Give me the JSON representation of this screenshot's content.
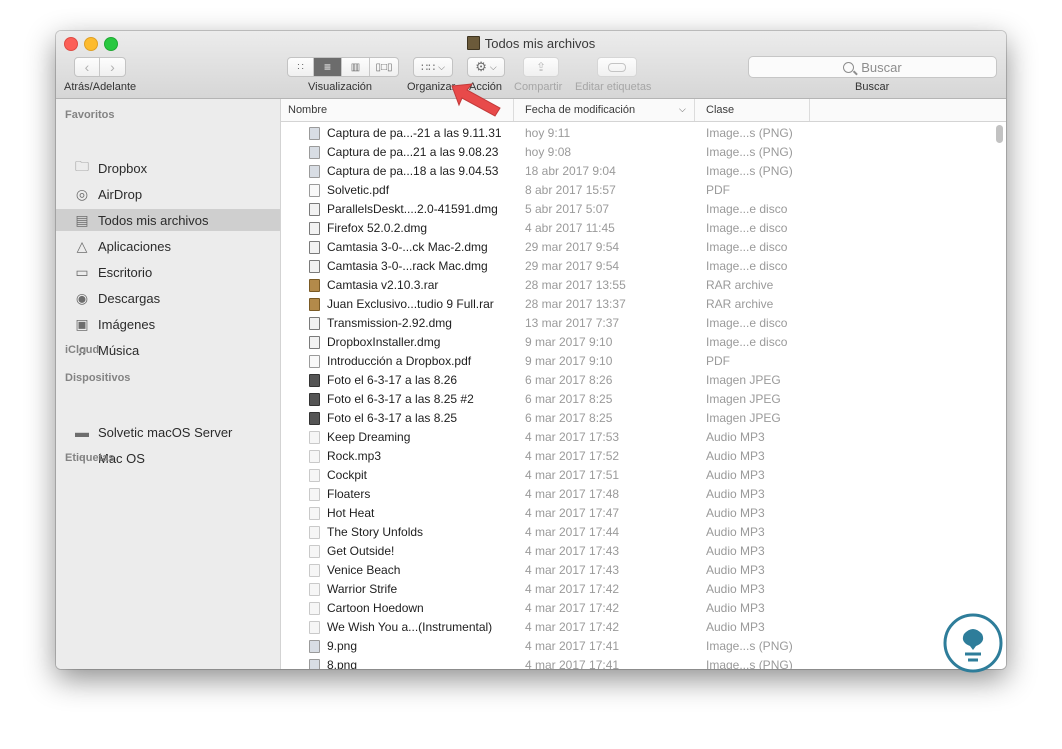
{
  "window": {
    "title": "Todos mis archivos"
  },
  "toolbar": {
    "nav_label": "Atrás/Adelante",
    "view_label": "Visualización",
    "organize_label": "Organizar",
    "action_label": "Acción",
    "share_label": "Compartir",
    "tags_label": "Editar etiquetas",
    "search_placeholder": "Buscar",
    "search_label": "Buscar"
  },
  "sidebar": {
    "favorites_header": "Favoritos",
    "favorites": [
      {
        "label": "Dropbox",
        "icon": "folder-icon"
      },
      {
        "label": "AirDrop",
        "icon": "airdrop-icon"
      },
      {
        "label": "Todos mis archivos",
        "icon": "all-files-icon",
        "selected": true
      },
      {
        "label": "Aplicaciones",
        "icon": "applications-icon"
      },
      {
        "label": "Escritorio",
        "icon": "desktop-icon"
      },
      {
        "label": "Descargas",
        "icon": "downloads-icon"
      },
      {
        "label": "Imágenes",
        "icon": "camera-icon"
      },
      {
        "label": "Música",
        "icon": "music-icon"
      }
    ],
    "icloud_header": "iCloud",
    "devices_header": "Dispositivos",
    "devices": [
      {
        "label": "Solvetic macOS Server",
        "icon": "server-icon"
      },
      {
        "label": "Mac OS",
        "icon": "disk-icon"
      }
    ],
    "tags_header": "Etiquetas"
  },
  "columns": {
    "name": "Nombre",
    "date": "Fecha de modificación",
    "kind": "Clase"
  },
  "files": [
    {
      "name": "Captura de pa...-21 a las 9.11.31",
      "date": "hoy 9:11",
      "kind": "Image...s (PNG)",
      "type": "png"
    },
    {
      "name": "Captura de pa...21 a las 9.08.23",
      "date": "hoy 9:08",
      "kind": "Image...s (PNG)",
      "type": "png"
    },
    {
      "name": "Captura de pa...18 a las 9.04.53",
      "date": "18 abr 2017 9:04",
      "kind": "Image...s (PNG)",
      "type": "png"
    },
    {
      "name": "Solvetic.pdf",
      "date": "8 abr 2017 15:57",
      "kind": "PDF",
      "type": "pdf"
    },
    {
      "name": "ParallelsDeskt....2.0-41591.dmg",
      "date": "5 abr 2017 5:07",
      "kind": "Image...e disco",
      "type": "dmg"
    },
    {
      "name": "Firefox 52.0.2.dmg",
      "date": "4 abr 2017 11:45",
      "kind": "Image...e disco",
      "type": "dmg"
    },
    {
      "name": "Camtasia 3-0-...ck Mac-2.dmg",
      "date": "29 mar 2017 9:54",
      "kind": "Image...e disco",
      "type": "dmg"
    },
    {
      "name": "Camtasia 3-0-...rack Mac.dmg",
      "date": "29 mar 2017 9:54",
      "kind": "Image...e disco",
      "type": "dmg"
    },
    {
      "name": "Camtasia v2.10.3.rar",
      "date": "28 mar 2017 13:55",
      "kind": "RAR archive",
      "type": "rar"
    },
    {
      "name": "Juan Exclusivo...tudio 9 Full.rar",
      "date": "28 mar 2017 13:37",
      "kind": "RAR archive",
      "type": "rar"
    },
    {
      "name": "Transmission-2.92.dmg",
      "date": "13 mar 2017 7:37",
      "kind": "Image...e disco",
      "type": "dmg"
    },
    {
      "name": "DropboxInstaller.dmg",
      "date": "9 mar 2017 9:10",
      "kind": "Image...e disco",
      "type": "dmg"
    },
    {
      "name": "Introducción a Dropbox.pdf",
      "date": "9 mar 2017 9:10",
      "kind": "PDF",
      "type": "pdf"
    },
    {
      "name": "Foto el 6-3-17 a las 8.26",
      "date": "6 mar 2017 8:26",
      "kind": "Imagen JPEG",
      "type": "jpg"
    },
    {
      "name": "Foto el 6-3-17 a las 8.25 #2",
      "date": "6 mar 2017 8:25",
      "kind": "Imagen JPEG",
      "type": "jpg"
    },
    {
      "name": "Foto el 6-3-17 a las 8.25",
      "date": "6 mar 2017 8:25",
      "kind": "Imagen JPEG",
      "type": "jpg"
    },
    {
      "name": "Keep Dreaming",
      "date": "4 mar 2017 17:53",
      "kind": "Audio MP3",
      "type": "mp3"
    },
    {
      "name": "Rock.mp3",
      "date": "4 mar 2017 17:52",
      "kind": "Audio MP3",
      "type": "mp3"
    },
    {
      "name": "Cockpit",
      "date": "4 mar 2017 17:51",
      "kind": "Audio MP3",
      "type": "mp3"
    },
    {
      "name": "Floaters",
      "date": "4 mar 2017 17:48",
      "kind": "Audio MP3",
      "type": "mp3"
    },
    {
      "name": "Hot Heat",
      "date": "4 mar 2017 17:47",
      "kind": "Audio MP3",
      "type": "mp3"
    },
    {
      "name": "The Story Unfolds",
      "date": "4 mar 2017 17:44",
      "kind": "Audio MP3",
      "type": "mp3"
    },
    {
      "name": "Get Outside!",
      "date": "4 mar 2017 17:43",
      "kind": "Audio MP3",
      "type": "mp3"
    },
    {
      "name": "Venice Beach",
      "date": "4 mar 2017 17:43",
      "kind": "Audio MP3",
      "type": "mp3"
    },
    {
      "name": "Warrior Strife",
      "date": "4 mar 2017 17:42",
      "kind": "Audio MP3",
      "type": "mp3"
    },
    {
      "name": "Cartoon Hoedown",
      "date": "4 mar 2017 17:42",
      "kind": "Audio MP3",
      "type": "mp3"
    },
    {
      "name": "We Wish You a...(Instrumental)",
      "date": "4 mar 2017 17:42",
      "kind": "Audio MP3",
      "type": "mp3"
    },
    {
      "name": "9.png",
      "date": "4 mar 2017 17:41",
      "kind": "Image...s (PNG)",
      "type": "png"
    },
    {
      "name": "8.png",
      "date": "4 mar 2017 17:41",
      "kind": "Image...s (PNG)",
      "type": "png"
    }
  ],
  "colors": {
    "selection": "#cfcfcf",
    "arrow": "#e84a4a",
    "watermark": "#2e7d9a"
  }
}
